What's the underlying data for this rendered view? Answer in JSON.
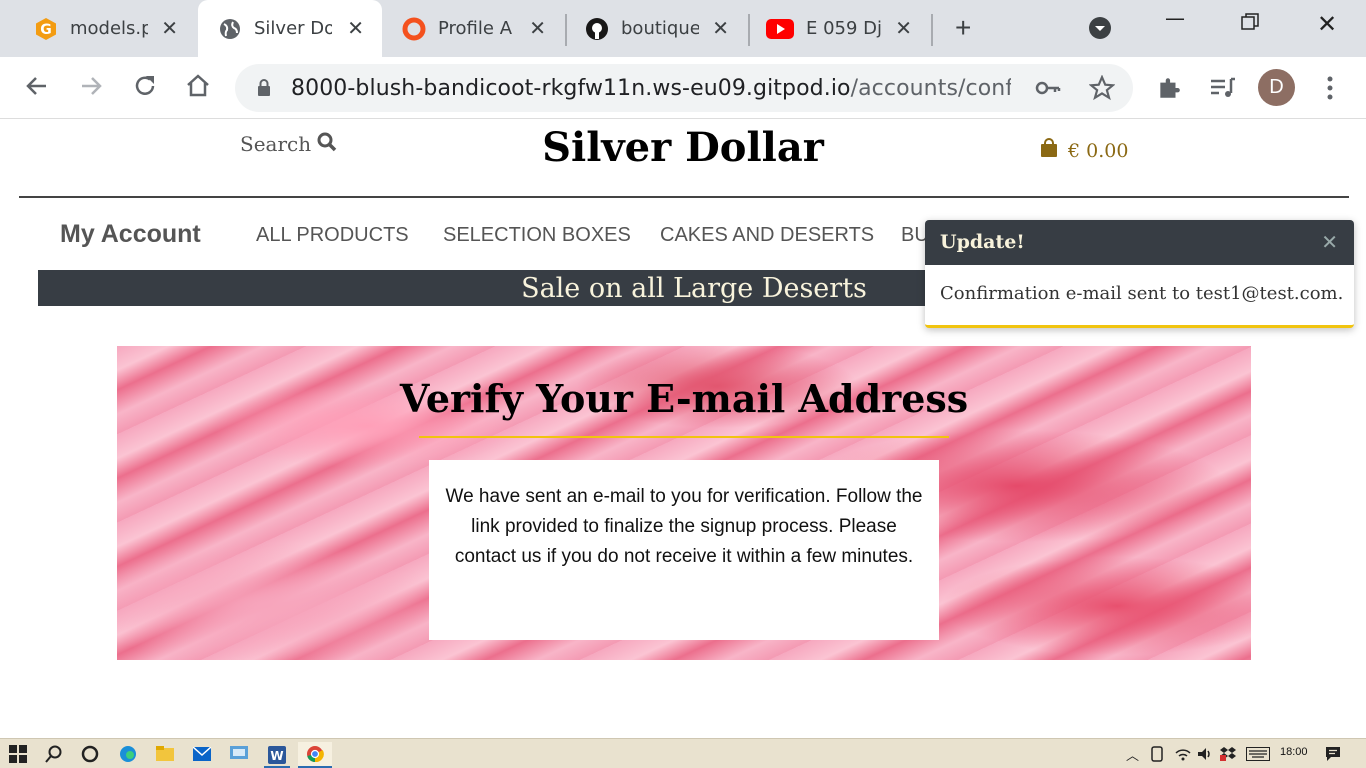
{
  "browser": {
    "tabs": [
      {
        "title": "models.p",
        "icon": "g-logo-icon"
      },
      {
        "title": "Silver Do",
        "icon": "globe-icon",
        "active": true
      },
      {
        "title": "Profile A",
        "icon": "ring-icon"
      },
      {
        "title": "boutique",
        "icon": "github-icon"
      },
      {
        "title": "E 059 Dj",
        "icon": "youtube-icon"
      }
    ],
    "url_host": "8000-blush-bandicoot-rkgfw11n.ws-eu09.gitpod.io",
    "url_path": "/accounts/confir…",
    "avatar_letter": "D"
  },
  "site": {
    "search_label": "Search",
    "brand": "Silver Dollar",
    "cart_total": "€ 0.00",
    "my_account": "My Account",
    "menu": [
      "ALL PRODUCTS",
      "SELECTION BOXES",
      "CAKES AND DESERTS",
      "BU"
    ],
    "banner": "Sale on all Large Deserts",
    "hero_title": "Verify Your E-mail Address",
    "hero_text": "We have sent an e-mail to you for verification. Follow the link provided to finalize the signup process. Please contact us if you do not receive it within a few minutes."
  },
  "toast": {
    "title": "Update!",
    "message": "Confirmation e-mail sent to test1@test.com."
  },
  "taskbar": {
    "clock": "18:00"
  },
  "colors": {
    "banner_bg": "#373d44",
    "accent_gold": "#f1c40f",
    "cart_gold": "#8b6914"
  }
}
